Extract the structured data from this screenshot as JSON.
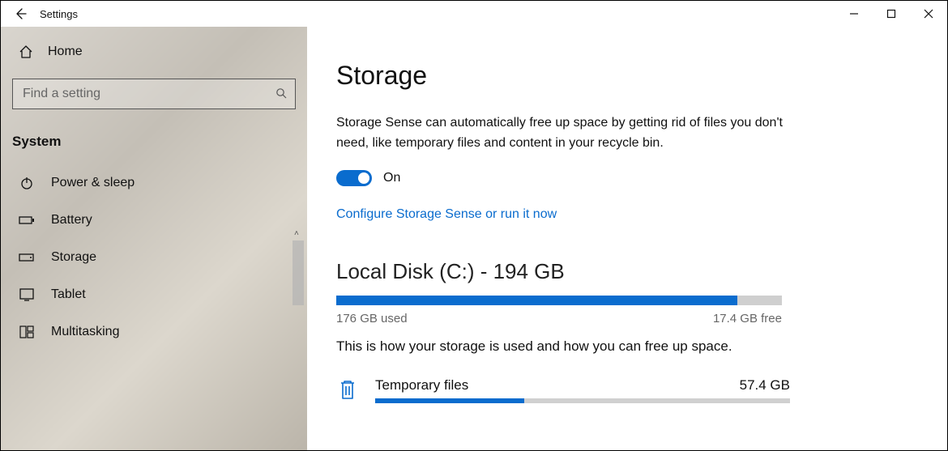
{
  "window": {
    "title": "Settings"
  },
  "sidebar": {
    "home_label": "Home",
    "search_placeholder": "Find a setting",
    "group_title": "System",
    "items": [
      {
        "icon": "power-icon",
        "label": "Power & sleep"
      },
      {
        "icon": "battery-icon",
        "label": "Battery"
      },
      {
        "icon": "storage-icon",
        "label": "Storage"
      },
      {
        "icon": "tablet-icon",
        "label": "Tablet"
      },
      {
        "icon": "multitask-icon",
        "label": "Multitasking"
      }
    ]
  },
  "main": {
    "title": "Storage",
    "sense_desc": "Storage Sense can automatically free up space by getting rid of files you don't need, like temporary files and content in your recycle bin.",
    "toggle_state": "On",
    "configure_link": "Configure Storage Sense or run it now",
    "disk_title": "Local Disk (C:) - 194 GB",
    "disk_used_pct": 90,
    "used_label": "176 GB used",
    "free_label": "17.4 GB free",
    "usage_desc": "This is how your storage is used and how you can free up space.",
    "categories": [
      {
        "icon": "trash-icon",
        "name": "Temporary files",
        "size": "57.4 GB",
        "pct": 36
      }
    ]
  }
}
